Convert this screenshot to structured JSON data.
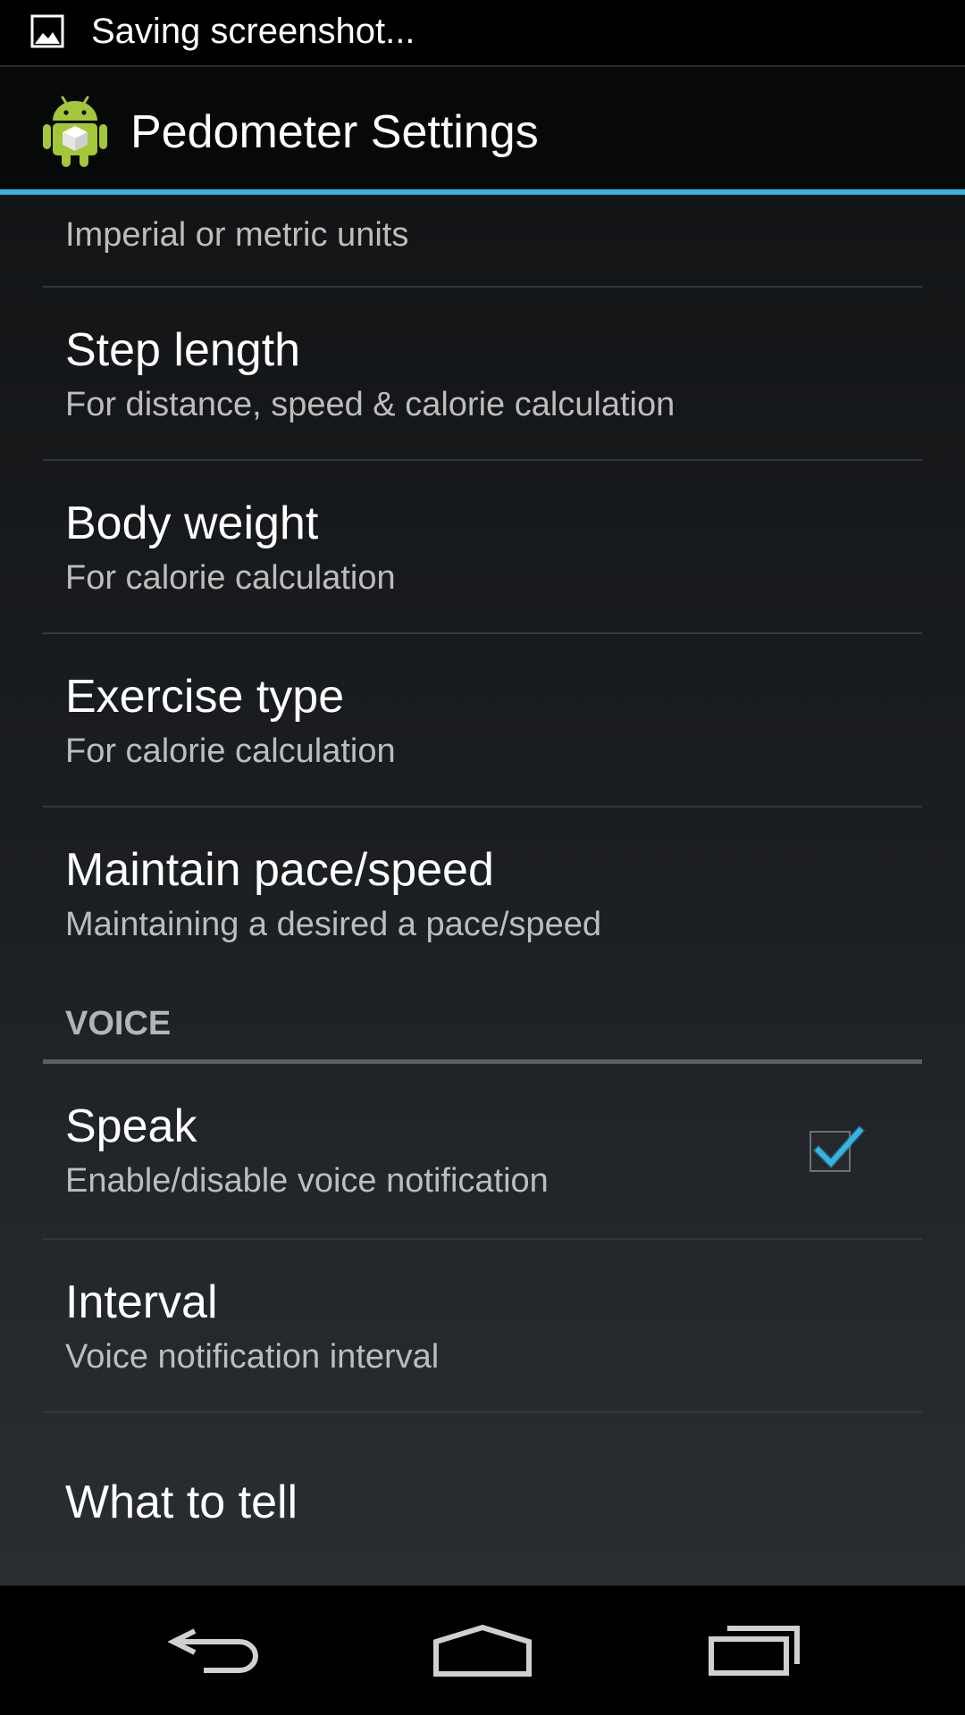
{
  "status_bar": {
    "notification_text": "Saving screenshot..."
  },
  "action_bar": {
    "title": "Pedometer Settings",
    "accent_color": "#33b5e5"
  },
  "preferences": {
    "units_summary": "Imperial or metric units",
    "step_length": {
      "title": "Step length",
      "summary": "For distance, speed & calorie calculation"
    },
    "body_weight": {
      "title": "Body weight",
      "summary": "For calorie calculation"
    },
    "exercise_type": {
      "title": "Exercise type",
      "summary": "For calorie calculation"
    },
    "maintain_pace": {
      "title": "Maintain pace/speed",
      "summary": "Maintaining a desired a pace/speed"
    },
    "voice_category": "VOICE",
    "speak": {
      "title": "Speak",
      "summary": "Enable/disable voice notification",
      "checked": true
    },
    "interval": {
      "title": "Interval",
      "summary": "Voice notification interval"
    },
    "what_to_tell": {
      "title": "What to tell"
    }
  },
  "nav_bar": {
    "buttons": [
      "back-icon",
      "home-icon",
      "recent-apps-icon"
    ]
  }
}
